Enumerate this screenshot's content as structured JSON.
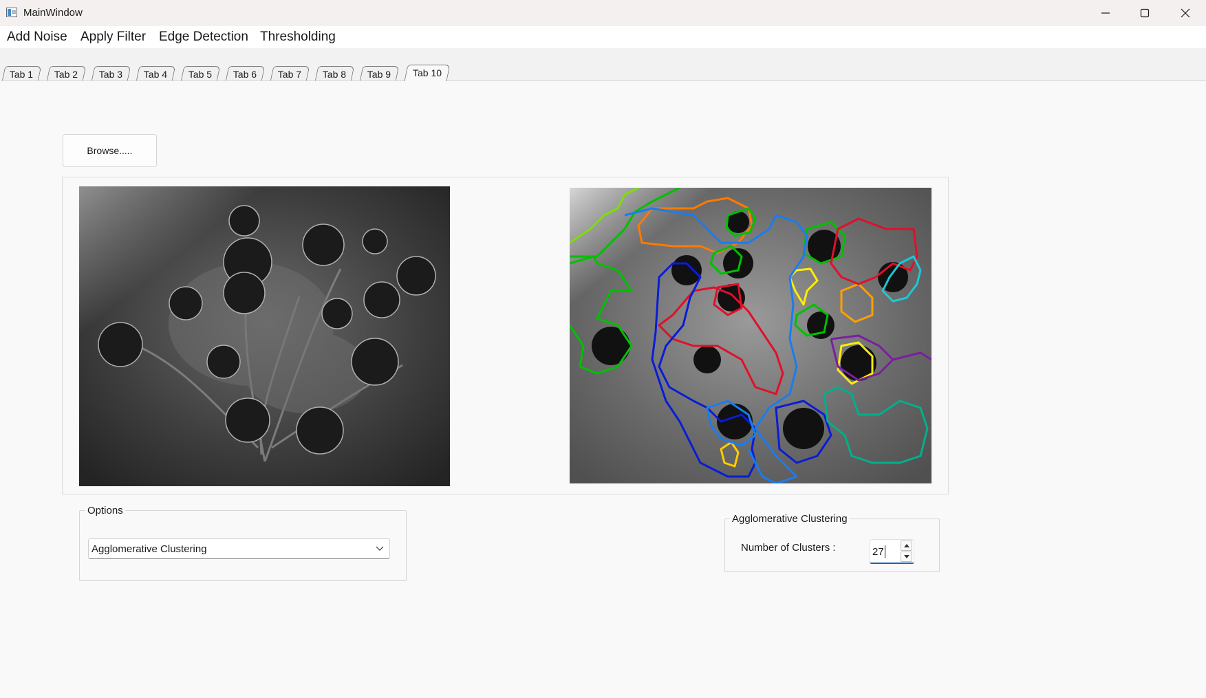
{
  "window": {
    "title": "MainWindow",
    "controls": [
      "minimize-icon",
      "maximize-icon",
      "close-icon"
    ]
  },
  "menu": {
    "items": [
      "Add Noise",
      "Apply Filter",
      "Edge Detection",
      "Thresholding"
    ]
  },
  "tabs": {
    "labels": [
      "Tab 1",
      "Tab 2",
      "Tab 3",
      "Tab 4",
      "Tab 5",
      "Tab 6",
      "Tab 7",
      "Tab 8",
      "Tab 9",
      "Tab 10"
    ],
    "active": "Tab 10"
  },
  "main": {
    "browse_label": "Browse.....",
    "images": [
      "grayscale-flowers-original",
      "grayscale-flowers-clustered-contours"
    ],
    "contour_colors": [
      "#00c000",
      "#ff7a00",
      "#1a7cf0",
      "#0a1cd6",
      "#e0102a",
      "#ffee00",
      "#7a1fa0",
      "#00b08a",
      "#1ec8d6"
    ]
  },
  "options": {
    "title": "Options",
    "selected": "Agglomerative Clustering"
  },
  "agglomerative": {
    "title": "Agglomerative Clustering",
    "clusters_label": "Number of Clusters :",
    "clusters_value": "27"
  }
}
